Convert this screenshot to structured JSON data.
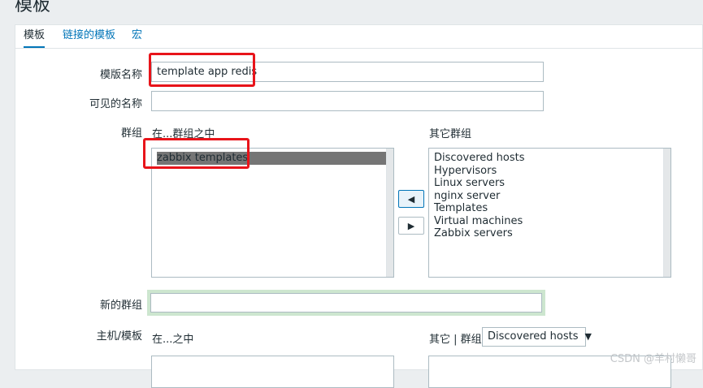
{
  "page": {
    "title": "模板"
  },
  "tabs": [
    {
      "label": "模板",
      "active": true
    },
    {
      "label": "链接的模板",
      "active": false
    },
    {
      "label": "宏",
      "active": false
    }
  ],
  "form": {
    "template_name_label": "模版名称",
    "template_name_value": "template app redis",
    "visible_name_label": "可见的名称",
    "visible_name_value": "",
    "groups_label": "群组",
    "in_groups_title": "在...群组之中",
    "other_groups_title": "其它群组",
    "in_groups": [
      "zabbix templates"
    ],
    "other_groups": [
      "Discovered hosts",
      "Hypervisors",
      "Linux servers",
      "nginx server",
      "Templates",
      "Virtual machines",
      "Zabbix servers"
    ],
    "new_group_label": "新的群组",
    "new_group_value": "",
    "hosts_label": "主机/模板",
    "in_hosts_title": "在...之中",
    "other_hosts_title": "其它 | 群组",
    "other_hosts_group_selected": "Discovered hosts"
  },
  "watermark": "CSDN @羊村懒哥",
  "colors": {
    "accent": "#0275b8",
    "highlight_red": "#e8141a",
    "selected_item": "#757575"
  }
}
